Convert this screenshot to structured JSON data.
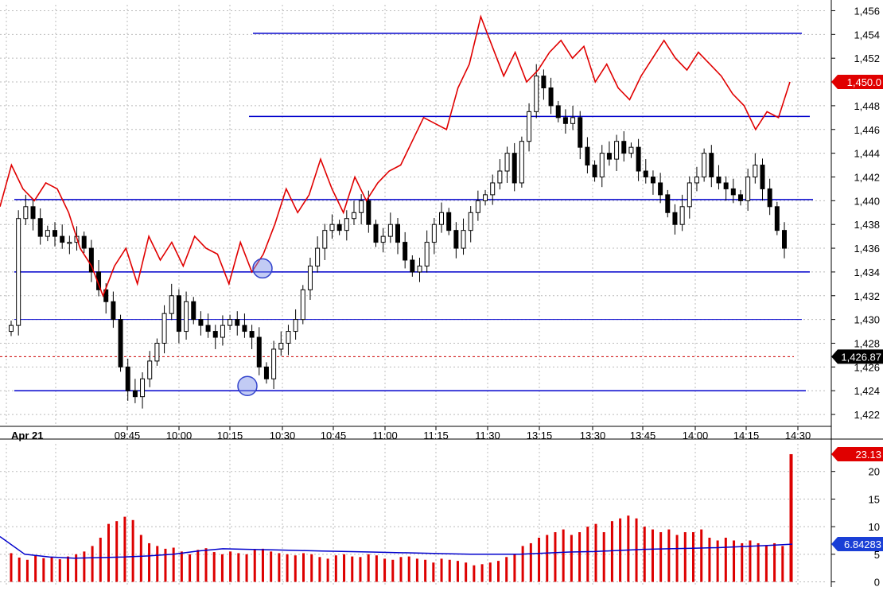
{
  "chart_data": [
    {
      "type": "candlestick",
      "panel": "price",
      "date_label": "Apr 21",
      "time_ticks": [
        "09:45",
        "10:00",
        "10:15",
        "10:30",
        "10:45",
        "11:00",
        "11:15",
        "11:30",
        "13:15",
        "13:30",
        "13:45",
        "14:00",
        "14:15",
        "14:30"
      ],
      "ylim": [
        1421,
        1456.5
      ],
      "yticks": [
        1422,
        1424,
        1426,
        1428,
        1430,
        1432,
        1434,
        1436,
        1438,
        1440,
        1442,
        1444,
        1446,
        1448,
        1450,
        1452,
        1454,
        1456
      ],
      "ytick_labels": [
        "1,422",
        "1,424",
        "1,426",
        "1,428",
        "1,430",
        "1,432",
        "1,434",
        "1,436",
        "1,438",
        "1,440",
        "1,442",
        "1,444",
        "1,446",
        "1,448",
        "1,450",
        "1,452",
        "1,454",
        "1,456"
      ],
      "grid": true,
      "candles_close_approx": [
        1429.5,
        1438.5,
        1439.5,
        1438.5,
        1437.0,
        1437.5,
        1437.0,
        1436.5,
        1436.5,
        1437.0,
        1436.0,
        1434.0,
        1432.5,
        1431.5,
        1430.0,
        1426.0,
        1424.0,
        1423.5,
        1425.0,
        1426.5,
        1428.0,
        1430.5,
        1432.0,
        1429.0,
        1431.5,
        1430.0,
        1429.5,
        1429.0,
        1428.5,
        1429.5,
        1430.0,
        1429.5,
        1429.0,
        1428.5,
        1426.0,
        1425.0,
        1427.5,
        1428.0,
        1429.0,
        1430.0,
        1432.5,
        1434.5,
        1436.0,
        1437.5,
        1438.0,
        1437.5,
        1438.5,
        1439.0,
        1440.0,
        1438.0,
        1436.5,
        1437.0,
        1438.0,
        1436.5,
        1435.0,
        1434.0,
        1434.5,
        1436.5,
        1438.0,
        1439.0,
        1437.5,
        1436.0,
        1437.5,
        1439.0,
        1440.0,
        1440.5,
        1441.5,
        1442.5,
        1444.0,
        1441.5,
        1445.0,
        1447.5,
        1450.5,
        1449.5,
        1448.0,
        1447.0,
        1446.5,
        1447.0,
        1444.5,
        1443.0,
        1442.0,
        1444.0,
        1443.5,
        1445.0,
        1444.0,
        1444.5,
        1442.5,
        1442.0,
        1441.5,
        1440.5,
        1439.0,
        1438.0,
        1439.5,
        1441.5,
        1442.0,
        1444.0,
        1442.0,
        1441.5,
        1441.0,
        1440.5,
        1440.0,
        1442.0,
        1443.0,
        1441.0,
        1439.5,
        1437.5,
        1436.0
      ],
      "overlay_line": {
        "color": "#e00000",
        "last_value_label": "1,450.0",
        "values_approx": [
          1439.5,
          1443.0,
          1441.0,
          1440.0,
          1441.5,
          1441.0,
          1439.0,
          1436.0,
          1434.5,
          1432.0,
          1434.5,
          1436.0,
          1433.0,
          1437.0,
          1435.0,
          1436.5,
          1434.5,
          1437.0,
          1436.0,
          1435.5,
          1433.0,
          1436.5,
          1434.0,
          1435.5,
          1438.0,
          1441.0,
          1439.0,
          1440.5,
          1443.5,
          1441.0,
          1439.0,
          1442.0,
          1440.0,
          1441.5,
          1442.5,
          1443.0,
          1445.0,
          1447.0,
          1446.5,
          1446.0,
          1449.5,
          1451.5,
          1455.5,
          1453.0,
          1450.5,
          1452.5,
          1450.0,
          1451.0,
          1452.5,
          1453.5,
          1452.0,
          1453.0,
          1450.0,
          1451.5,
          1449.5,
          1448.5,
          1450.5,
          1452.0,
          1453.5,
          1452.0,
          1451.0,
          1452.5,
          1451.5,
          1450.5,
          1449.0,
          1448.0,
          1446.0,
          1447.5,
          1447.0,
          1450.0
        ]
      },
      "horizontal_lines": [
        {
          "value": 1454.1,
          "color": "#0000cc"
        },
        {
          "value": 1447.1,
          "color": "#0000cc"
        },
        {
          "value": 1440.1,
          "color": "#0000cc"
        },
        {
          "value": 1434.0,
          "color": "#0000cc"
        },
        {
          "value": 1430.0,
          "color": "#0000cc"
        },
        {
          "value": 1424.0,
          "color": "#0000cc"
        }
      ],
      "reference_line": {
        "value": 1426.87,
        "color": "#cc0000",
        "style": "dashed"
      },
      "last_price_label": "1,426.87",
      "markers": [
        {
          "label": "marker-low",
          "value": 1424.4
        },
        {
          "label": "marker-high",
          "value": 1434.3
        }
      ]
    },
    {
      "type": "bar",
      "panel": "volume",
      "ylim": [
        -0.5,
        25
      ],
      "yticks": [
        0,
        5,
        10,
        15,
        20
      ],
      "grid": true,
      "bar_color": "#dd0000",
      "last_bar_label": "23.13",
      "values_approx": [
        5.2,
        4.4,
        4.0,
        4.8,
        4.3,
        4.5,
        4.1,
        4.6,
        5.0,
        5.5,
        6.5,
        8.0,
        10.5,
        11.0,
        11.8,
        11.2,
        8.5,
        7.0,
        6.5,
        6.0,
        6.2,
        5.5,
        5.0,
        5.8,
        6.1,
        5.4,
        5.0,
        5.5,
        5.2,
        5.0,
        5.8,
        6.0,
        5.5,
        5.2,
        5.0,
        4.8,
        5.2,
        5.0,
        4.5,
        4.2,
        4.8,
        5.0,
        4.6,
        4.5,
        5.0,
        4.8,
        4.2,
        4.0,
        4.5,
        4.6,
        4.2,
        4.0,
        3.5,
        4.2,
        4.0,
        3.8,
        3.5,
        3.0,
        3.2,
        3.5,
        3.8,
        4.5,
        5.0,
        6.5,
        7.0,
        8.0,
        8.5,
        9.0,
        9.5,
        8.5,
        9.0,
        10.0,
        10.5,
        9.0,
        11.0,
        11.5,
        12.0,
        11.5,
        10.0,
        9.5,
        9.0,
        9.5,
        8.5,
        9.0,
        9.0,
        9.5,
        8.0,
        7.5,
        8.0,
        7.5,
        7.0,
        7.5,
        7.0,
        6.5,
        7.0,
        6.5,
        23.13
      ],
      "average_line": {
        "color": "#0000cc",
        "last_value_label": "6.84283",
        "values_approx": [
          8.2,
          5.0,
          4.5,
          4.3,
          4.4,
          4.5,
          4.7,
          5.0,
          5.6,
          6.0,
          5.9,
          5.8,
          5.7,
          5.6,
          5.5,
          5.4,
          5.3,
          5.2,
          5.1,
          5.0,
          5.0,
          5.0,
          5.2,
          5.4,
          5.5,
          5.7,
          5.9,
          6.0,
          6.1,
          6.2,
          6.4,
          6.6,
          6.84
        ]
      }
    }
  ]
}
